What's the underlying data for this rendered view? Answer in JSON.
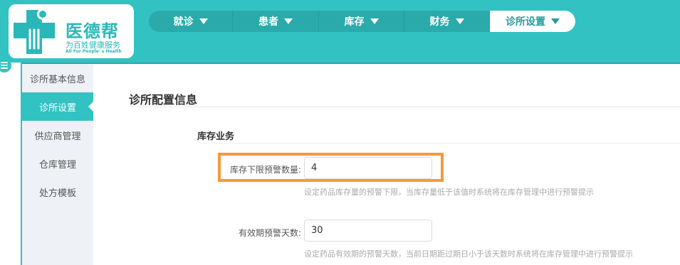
{
  "logo": {
    "title": "医德帮",
    "subtitle": "为百姓健康服务",
    "tagline": "All For People' s Health"
  },
  "nav": {
    "items": [
      {
        "label": "就诊",
        "active": false
      },
      {
        "label": "患者",
        "active": false
      },
      {
        "label": "库存",
        "active": false
      },
      {
        "label": "财务",
        "active": false
      },
      {
        "label": "诊所设置",
        "active": true
      }
    ]
  },
  "sidebar": {
    "items": [
      {
        "label": "诊所基本信息",
        "active": false
      },
      {
        "label": "诊所设置",
        "active": true
      },
      {
        "label": "供应商管理",
        "active": false
      },
      {
        "label": "仓库管理",
        "active": false
      },
      {
        "label": "处方模板",
        "active": false
      }
    ]
  },
  "main": {
    "section_title": "诊所配置信息",
    "subsection_title": "库存业务",
    "fields": [
      {
        "label": "库存下限预警数量:",
        "value": "4",
        "hint": "设定药品库存量的预警下限，当库存量低于该值时系统将在库存管理中进行预警提示"
      },
      {
        "label": "有效期预警天数:",
        "value": "30",
        "hint": "设定药品有效期的预警天数，当前日期距过期日小于该天数时系统将在库存管理中进行预警提示"
      }
    ]
  },
  "colors": {
    "primary": "#33c2c2",
    "highlight": "#f39a3e",
    "sidebar_bg": "#eef1f6"
  }
}
